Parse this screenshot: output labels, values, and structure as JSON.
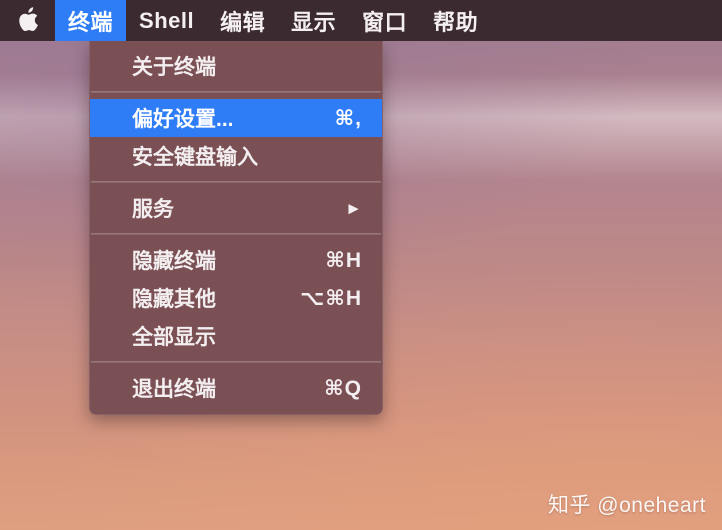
{
  "menubar": {
    "apple_icon": "apple-logo-icon",
    "items": [
      {
        "label": "终端",
        "active": true
      },
      {
        "label": "Shell",
        "active": false
      },
      {
        "label": "编辑",
        "active": false
      },
      {
        "label": "显示",
        "active": false
      },
      {
        "label": "窗口",
        "active": false
      },
      {
        "label": "帮助",
        "active": false
      }
    ]
  },
  "menu": {
    "owner": "终端",
    "groups": [
      {
        "items": [
          {
            "label": "关于终端",
            "shortcut": "",
            "submenu": false,
            "highlighted": false
          }
        ]
      },
      {
        "items": [
          {
            "label": "偏好设置...",
            "shortcut": "⌘,",
            "submenu": false,
            "highlighted": true
          },
          {
            "label": "安全键盘输入",
            "shortcut": "",
            "submenu": false,
            "highlighted": false
          }
        ]
      },
      {
        "items": [
          {
            "label": "服务",
            "shortcut": "",
            "submenu": true,
            "highlighted": false
          }
        ]
      },
      {
        "items": [
          {
            "label": "隐藏终端",
            "shortcut": "⌘H",
            "submenu": false,
            "highlighted": false
          },
          {
            "label": "隐藏其他",
            "shortcut": "⌥⌘H",
            "submenu": false,
            "highlighted": false
          },
          {
            "label": "全部显示",
            "shortcut": "",
            "submenu": false,
            "highlighted": false
          }
        ]
      },
      {
        "items": [
          {
            "label": "退出终端",
            "shortcut": "⌘Q",
            "submenu": false,
            "highlighted": false
          }
        ]
      }
    ],
    "submenu_arrow_glyph": "►"
  },
  "watermark": {
    "text": "知乎 @oneheart"
  },
  "colors": {
    "menubar_bg": "#3c2a31",
    "menu_bg": "#7b5055",
    "highlight": "#2f7df6",
    "text": "#f3eef0",
    "wallpaper_top": "#9d7b92",
    "wallpaper_bottom": "#de9f81"
  }
}
